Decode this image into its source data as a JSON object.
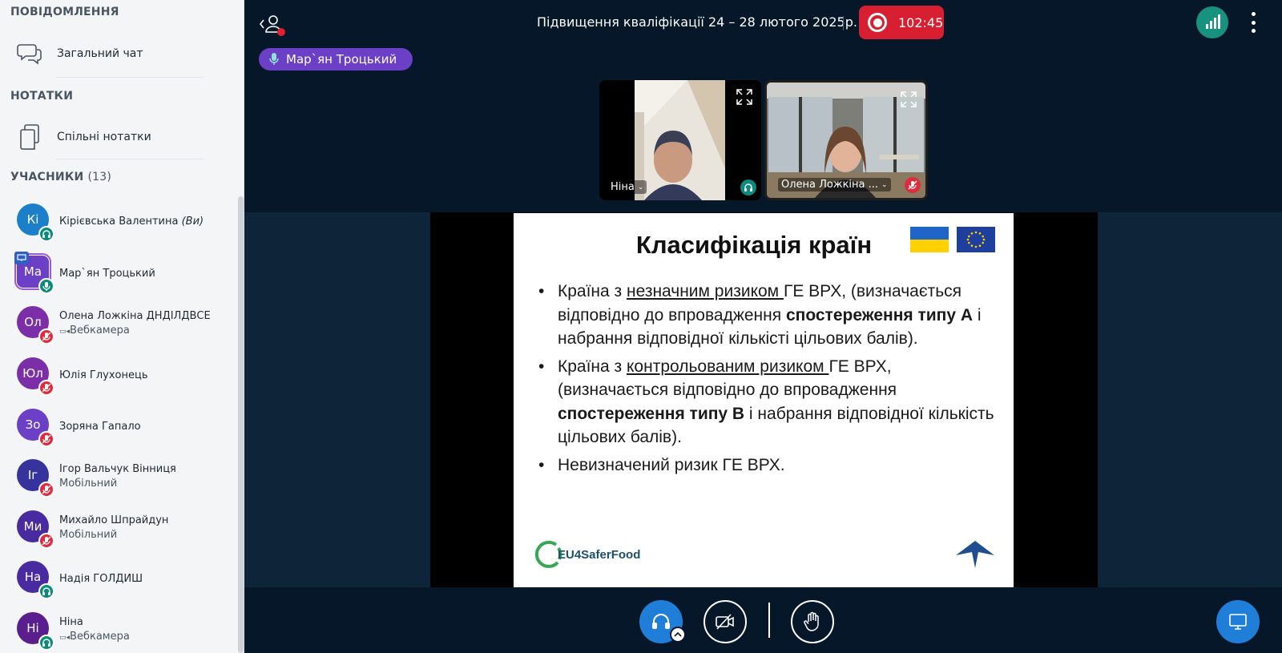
{
  "sidebar": {
    "messages_title": "ПОВІДОМЛЕННЯ",
    "public_chat_label": "Загальний чат",
    "notes_title": "НОТАТКИ",
    "shared_notes_label": "Спільні нотатки",
    "participants_title": "УЧАСНИКИ",
    "participants_count": "(13)",
    "participants": [
      {
        "initials": "Кі",
        "name": "Кірієвська Валентина",
        "you": "(Ви)",
        "sub": "",
        "color": "#1b7fc9",
        "status": "listen"
      },
      {
        "initials": "Ма",
        "name": "Мар`ян Троцький",
        "sub": "",
        "color": "#6b3fc6",
        "status": "mic",
        "presenter": true
      },
      {
        "initials": "Ол",
        "name": "Олена Ложкіна ДНДІЛДВСЕ",
        "sub": "Вебкамера",
        "color": "#7b2ea8",
        "status": "muted"
      },
      {
        "initials": "Юл",
        "name": "Юлія Глухонець",
        "sub": "",
        "color": "#7b2ea8",
        "status": "muted"
      },
      {
        "initials": "Зо",
        "name": "Зоряна Гапало",
        "sub": "",
        "color": "#6b3fc6",
        "status": "muted"
      },
      {
        "initials": "Іг",
        "name": "Ігор Вальчук Вінниця",
        "sub": "Мобільний",
        "color": "#36349c",
        "status": "muted"
      },
      {
        "initials": "Ми",
        "name": "Михайло Шпрайдун",
        "sub": "Мобільний",
        "color": "#4a2aa0",
        "status": "muted"
      },
      {
        "initials": "На",
        "name": "Надія ГОЛДИШ",
        "sub": "",
        "color": "#4a2aa0",
        "status": "listen"
      },
      {
        "initials": "Ні",
        "name": "Ніна",
        "sub": "Вебкамера",
        "color": "#5a1e8e",
        "status": "listen"
      }
    ]
  },
  "header": {
    "meeting_title": "Підвищення кваліфікації 24 – 28 лютого 2025р.",
    "recording_time": "102:45",
    "talking_name": "Мар`ян Троцький"
  },
  "videos": [
    {
      "name": "Ніна",
      "status": "listen"
    },
    {
      "name": "Олена Ложкіна ...",
      "status": "muted"
    }
  ],
  "slide": {
    "title": "Класифікація країн",
    "bullet1_pre": "Країна з ",
    "bullet1_u": "незначним ризиком ",
    "bullet1_mid": "ГЕ ВРХ, (визначається відповідно до впровадження ",
    "bullet1_b": "спостереження типу А",
    "bullet1_post": " і набрання відповідної кількісті цільових балів).",
    "bullet2_pre": "Країна з ",
    "bullet2_u": "контрольованим ризиком ",
    "bullet2_mid": "ГЕ ВРХ, (визначається відповідно до впровадження ",
    "bullet2_b": "спостереження типу В",
    "bullet2_post": " і набрання відповідної кількість цільових балів).",
    "bullet3": "Невизначений ризик ГЕ ВРХ.",
    "footer_logo": "EU4SaferFood"
  },
  "colors": {
    "background": "#06172a",
    "record": "#d71f31",
    "primary": "#1f7fd8",
    "talker": "#6b3fc6"
  }
}
